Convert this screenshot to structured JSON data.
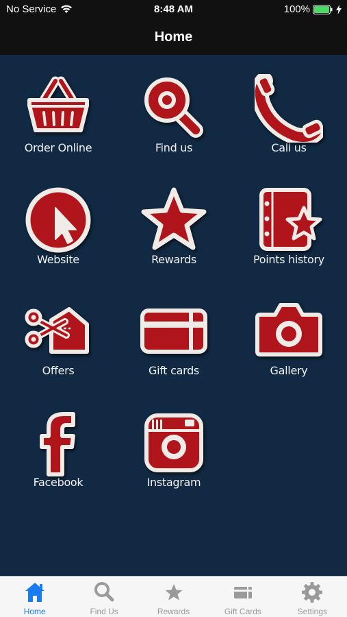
{
  "status_bar": {
    "carrier": "No Service",
    "time": "8:48 AM",
    "battery": "100%"
  },
  "header": {
    "title": "Home"
  },
  "tiles": [
    {
      "label": "Order Online",
      "icon": "basket-icon"
    },
    {
      "label": "Find us",
      "icon": "magnifier-icon"
    },
    {
      "label": "Call us",
      "icon": "phone-icon"
    },
    {
      "label": "Website",
      "icon": "cursor-icon"
    },
    {
      "label": "Rewards",
      "icon": "star-icon"
    },
    {
      "label": "Points history",
      "icon": "notebook-star-icon"
    },
    {
      "label": "Offers",
      "icon": "scissors-coupon-icon"
    },
    {
      "label": "Gift cards",
      "icon": "gift-card-icon"
    },
    {
      "label": "Gallery",
      "icon": "camera-icon"
    },
    {
      "label": "Facebook",
      "icon": "facebook-icon"
    },
    {
      "label": "Instagram",
      "icon": "instagram-icon"
    }
  ],
  "tabs": [
    {
      "label": "Home",
      "icon": "home-icon",
      "active": true
    },
    {
      "label": "Find Us",
      "icon": "search-icon",
      "active": false
    },
    {
      "label": "Rewards",
      "icon": "star-icon",
      "active": false
    },
    {
      "label": "Gift Cards",
      "icon": "gift-card-icon",
      "active": false
    },
    {
      "label": "Settings",
      "icon": "gear-icon",
      "active": false
    }
  ],
  "colors": {
    "background": "#112942",
    "bar_background": "#111111",
    "icon_red": "#b0151b",
    "icon_border": "#f0ebe6",
    "tab_active": "#1a7cf5",
    "tab_inactive": "#9a9a9a"
  }
}
